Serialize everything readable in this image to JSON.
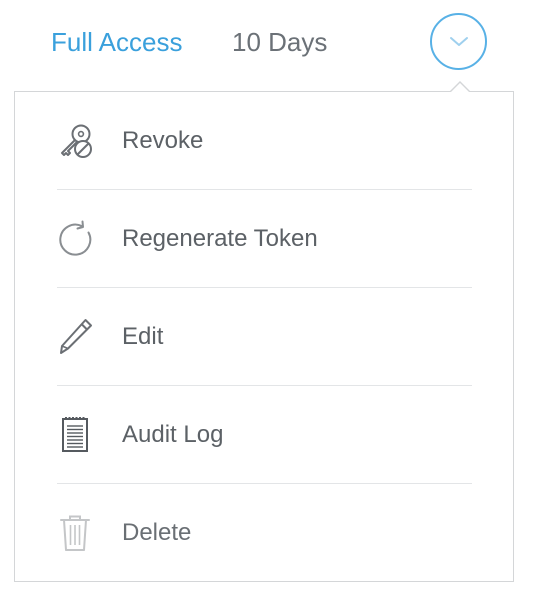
{
  "header": {
    "access_level": "Full Access",
    "duration": "10 Days",
    "toggle_icon": "chevron-down-icon"
  },
  "colors": {
    "accent": "#3aa0dc",
    "text": "#5c6166",
    "icon": "#6b6f74",
    "icon_disabled": "#c4c6c8",
    "border": "#d4d6d8"
  },
  "menu": {
    "items": [
      {
        "label": "Revoke",
        "icon": "key-revoke-icon",
        "enabled": true
      },
      {
        "label": "Regenerate Token",
        "icon": "refresh-icon",
        "enabled": true
      },
      {
        "label": "Edit",
        "icon": "pencil-icon",
        "enabled": true
      },
      {
        "label": "Audit Log",
        "icon": "notepad-icon",
        "enabled": true
      },
      {
        "label": "Delete",
        "icon": "trash-icon",
        "enabled": false
      }
    ]
  }
}
